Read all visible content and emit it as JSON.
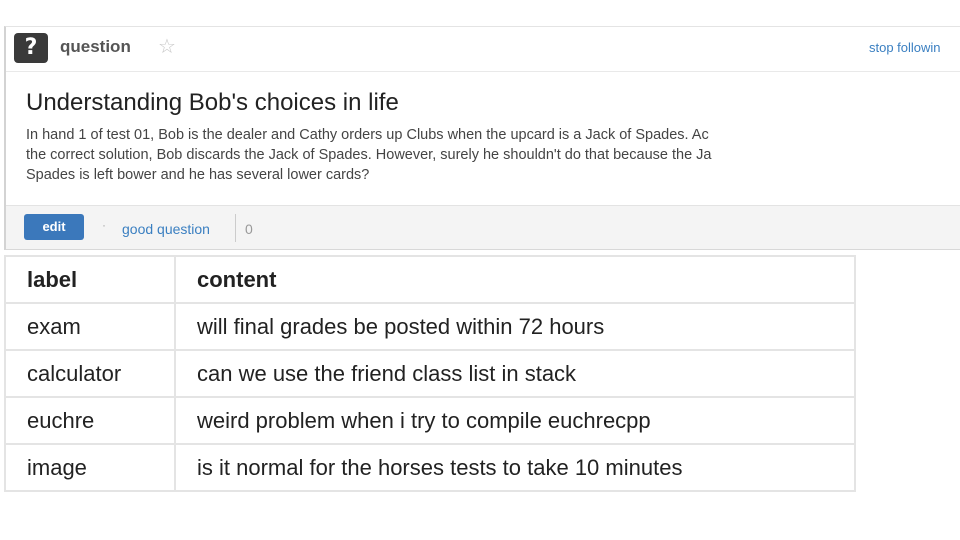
{
  "post": {
    "type_badge": "?",
    "type_label": "question",
    "star_glyph": "☆",
    "follow_link": "stop followin",
    "title": "Understanding Bob's choices in life",
    "body_lines": [
      "In hand 1 of test 01, Bob is the dealer and Cathy orders up Clubs when the upcard is a Jack of Spades. Ac",
      "the correct solution, Bob discards the Jack of Spades. However, surely he shouldn't do that because the Ja",
      "Spades is left bower and he has several lower cards?"
    ],
    "footer": {
      "edit_label": "edit",
      "separator": "·",
      "good_question_label": "good question",
      "good_question_count": "0"
    }
  },
  "table": {
    "headers": [
      "label",
      "content"
    ],
    "rows": [
      [
        "exam",
        "will final grades be posted within 72 hours"
      ],
      [
        "calculator",
        "can we use the friend class list in stack"
      ],
      [
        "euchre",
        "weird problem when i try to compile euchrecpp"
      ],
      [
        "image",
        "is it normal for the horses tests to take 10 minutes"
      ]
    ]
  },
  "colors": {
    "link": "#3a7fc1",
    "edit_button": "#3b78bb",
    "badge": "#3a3a3a"
  }
}
